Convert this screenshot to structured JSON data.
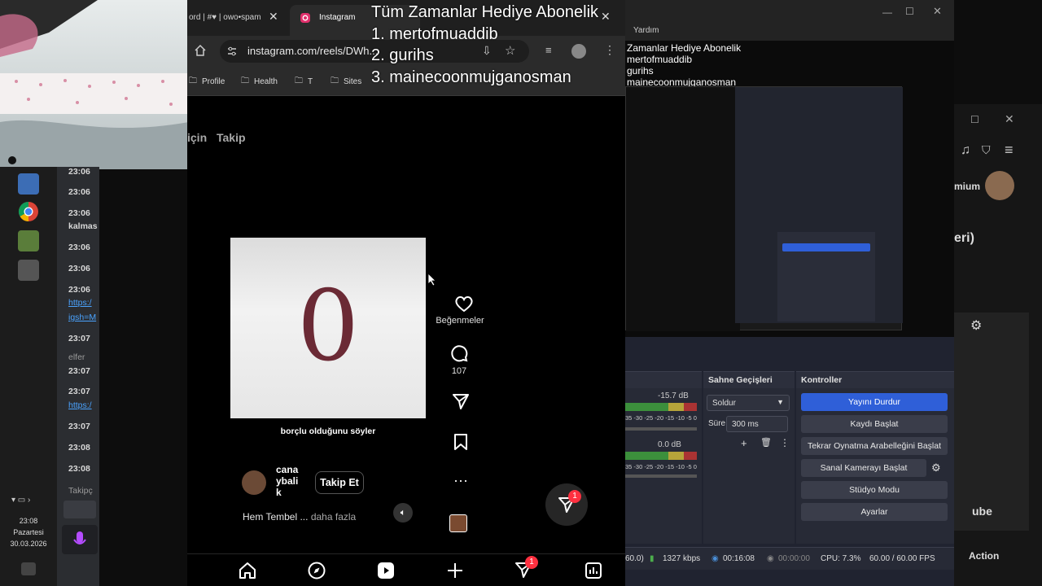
{
  "overlay": {
    "heading": "Tüm Zamanlar Hediye  Abonelik",
    "entries": [
      "1. mertofmuaddib",
      "2. gurihs",
      "3. mainecoonmujganosman"
    ]
  },
  "taskbar": {
    "time": "23:08",
    "day": "Pazartesi",
    "date": "30.03.2026"
  },
  "discord": {
    "lines": [
      {
        "text": "23:06",
        "style": "time"
      },
      {
        "text": "23:06",
        "style": "time"
      },
      {
        "text": "23:06",
        "style": "time"
      },
      {
        "text": "kalmas",
        "style": "text"
      },
      {
        "text": "23:06",
        "style": "time"
      },
      {
        "text": "23:06",
        "style": "time"
      },
      {
        "text": "23:06",
        "style": "time"
      },
      {
        "text": "https:/",
        "style": "link"
      },
      {
        "text": "igsh=M",
        "style": "link"
      },
      {
        "text": "23:07",
        "style": "time"
      },
      {
        "text": "elfer",
        "style": "gray"
      },
      {
        "text": "23:07",
        "style": "time"
      },
      {
        "text": "23:07",
        "style": "time"
      },
      {
        "text": "https:/",
        "style": "link"
      },
      {
        "text": "23:07",
        "style": "time"
      },
      {
        "text": "23:08",
        "style": "time"
      },
      {
        "text": "23:08",
        "style": "time"
      },
      {
        "text": "Takipç",
        "style": "gray"
      }
    ]
  },
  "chrome": {
    "tabs": [
      {
        "label": "ord | #♥ | owo•spam"
      },
      {
        "label": "Instagram"
      }
    ],
    "url": "instagram.com/reels/DWh...",
    "bookmarks": [
      "Profile",
      "Health",
      "T",
      "Sites"
    ]
  },
  "instagram": {
    "feed_tabs": [
      "için",
      "Takip"
    ],
    "video_number": "0",
    "subtitle": "borçlu olduğunu söyler",
    "author": "cana ybali k",
    "follow_label": "Takip Et",
    "caption": "Hem Tembel ...",
    "more_label": "daha fazla",
    "like_label": "Beğenmeler",
    "comment_count": "107",
    "notif_count": "1",
    "nav_badge": "1"
  },
  "obs": {
    "menu_item": "Yardım",
    "preview_text": [
      "Zamanlar Hediye  Abonelik",
      "mertofmuaddib",
      "gurihs",
      "mainecoonmujganosman"
    ],
    "audio_levels": [
      "-15.7 dB",
      "0.0 dB"
    ],
    "meter_ticks": "35 -30 -25 -20 -15 -10 -5  0",
    "transitions": {
      "title": "Sahne Geçişleri",
      "selected": "Soldur",
      "duration_label": "Süre",
      "duration_value": "300 ms"
    },
    "controls": {
      "title": "Kontroller",
      "buttons": [
        "Yayını Durdur",
        "Kaydı Başlat",
        "Tekrar Oynatma Arabelleğini Başlat",
        "Sanal Kamerayı Başlat",
        "Stüdyo Modu",
        "Ayarlar"
      ]
    },
    "status": {
      "fps_partial": "60.0)",
      "bitrate": "1327 kbps",
      "live_time": "00:16:08",
      "rec_time": "00:00:00",
      "cpu": "CPU: 7.3%",
      "fps": "60.00 / 60.00 FPS"
    }
  },
  "rightwin": {
    "label_premium": "mium",
    "label_eri": "eri)",
    "label_ube": "ube",
    "action": "Action"
  },
  "colors": {
    "obs_primary": "#2f5fd8",
    "ig_badge": "#ff3040",
    "link": "#4aa3ff"
  }
}
